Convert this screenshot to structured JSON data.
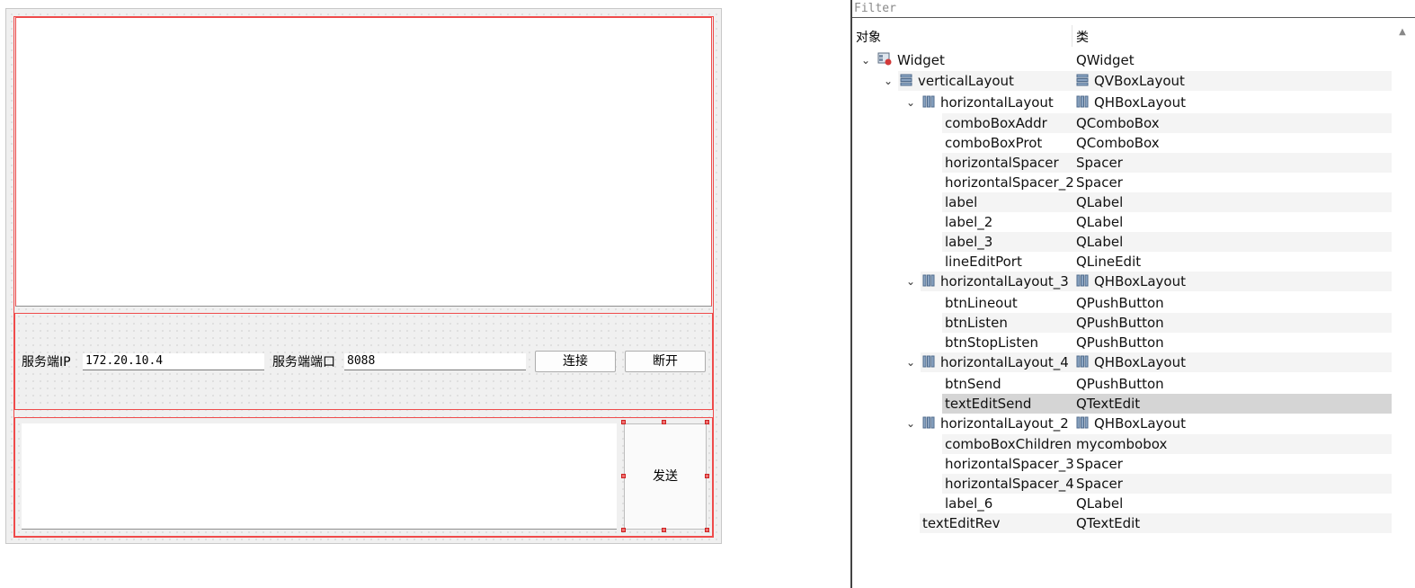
{
  "form": {
    "server_ip_label": "服务端IP",
    "server_ip_value": "172.20.10.4",
    "server_port_label": "服务端端口",
    "server_port_value": "8088",
    "connect_button": "连接",
    "disconnect_button": "断开",
    "send_button": "发送"
  },
  "inspector": {
    "filter_placeholder": "Filter",
    "header_object": "对象",
    "header_class": "类",
    "rows": [
      {
        "name": "Widget",
        "cls": "QWidget"
      },
      {
        "name": "verticalLayout",
        "cls": "QVBoxLayout"
      },
      {
        "name": "horizontalLayout",
        "cls": "QHBoxLayout"
      },
      {
        "name": "comboBoxAddr",
        "cls": "QComboBox"
      },
      {
        "name": "comboBoxProt",
        "cls": "QComboBox"
      },
      {
        "name": "horizontalSpacer",
        "cls": "Spacer"
      },
      {
        "name": "horizontalSpacer_2",
        "cls": "Spacer"
      },
      {
        "name": "label",
        "cls": "QLabel"
      },
      {
        "name": "label_2",
        "cls": "QLabel"
      },
      {
        "name": "label_3",
        "cls": "QLabel"
      },
      {
        "name": "lineEditPort",
        "cls": "QLineEdit"
      },
      {
        "name": "horizontalLayout_3",
        "cls": "QHBoxLayout"
      },
      {
        "name": "btnLineout",
        "cls": "QPushButton"
      },
      {
        "name": "btnListen",
        "cls": "QPushButton"
      },
      {
        "name": "btnStopListen",
        "cls": "QPushButton"
      },
      {
        "name": "horizontalLayout_4",
        "cls": "QHBoxLayout"
      },
      {
        "name": "btnSend",
        "cls": "QPushButton"
      },
      {
        "name": "textEditSend",
        "cls": "QTextEdit"
      },
      {
        "name": "horizontalLayout_2",
        "cls": "QHBoxLayout"
      },
      {
        "name": "comboBoxChildren",
        "cls": "mycombobox"
      },
      {
        "name": "horizontalSpacer_3",
        "cls": "Spacer"
      },
      {
        "name": "horizontalSpacer_4",
        "cls": "Spacer"
      },
      {
        "name": "label_6",
        "cls": "QLabel"
      },
      {
        "name": "textEditRev",
        "cls": "QTextEdit"
      }
    ]
  }
}
